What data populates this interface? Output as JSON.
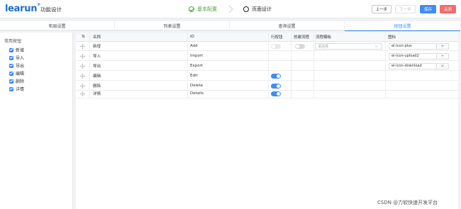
{
  "header": {
    "logo": "learun",
    "logo_mark": "®",
    "title": "功能设计",
    "steps": [
      {
        "label": "基本配置",
        "state": "done"
      },
      {
        "label": "页面设计",
        "state": "current"
      }
    ],
    "buttons": {
      "prev": "上一步",
      "next": "下一步",
      "save": "保存",
      "close": "关闭"
    }
  },
  "tabs": [
    {
      "label": "布局设置",
      "active": false
    },
    {
      "label": "列表设置",
      "active": false
    },
    {
      "label": "查询设置",
      "active": false
    },
    {
      "label": "按钮设置",
      "active": true
    }
  ],
  "left_panel": {
    "title": "常用按钮",
    "items": [
      {
        "label": "新增",
        "checked": true
      },
      {
        "label": "导入",
        "checked": true
      },
      {
        "label": "导出",
        "checked": true
      },
      {
        "label": "编辑",
        "checked": true
      },
      {
        "label": "删除",
        "checked": true
      },
      {
        "label": "详情",
        "checked": true
      }
    ]
  },
  "grid": {
    "columns": {
      "drag": "⇅",
      "name": "名称",
      "id": "ID",
      "row_button": "行按钮",
      "create_flow": "创建流程",
      "flow_template": "流程模板",
      "icon": "图标"
    },
    "rows": [
      {
        "name": "新增",
        "id": "Add",
        "row_button": false,
        "create_flow": false,
        "flow_template": "请选择",
        "icon": "el-icon-plus",
        "icon_btn": "+"
      },
      {
        "name": "导入",
        "id": "Import",
        "row_button": null,
        "create_flow": null,
        "flow_template": null,
        "icon": "el-icon-upload2",
        "icon_btn": "÷"
      },
      {
        "name": "导出",
        "id": "Export",
        "row_button": null,
        "create_flow": null,
        "flow_template": null,
        "icon": "el-icon-download",
        "icon_btn": "×"
      },
      {
        "name": "编辑",
        "id": "Edit",
        "row_button": true,
        "create_flow": null,
        "flow_template": null,
        "icon": null,
        "icon_btn": null
      },
      {
        "name": "删除",
        "id": "Delete",
        "row_button": true,
        "create_flow": null,
        "flow_template": null,
        "icon": null,
        "icon_btn": null
      },
      {
        "name": "详情",
        "id": "Details",
        "row_button": true,
        "create_flow": null,
        "flow_template": null,
        "icon": null,
        "icon_btn": null
      }
    ]
  },
  "watermark": "CSDN @力软快速开发平台",
  "colors": {
    "brand": "#1a6fd1",
    "accent": "#3f8cf3",
    "success": "#52a63c",
    "danger": "#f36d6d"
  }
}
